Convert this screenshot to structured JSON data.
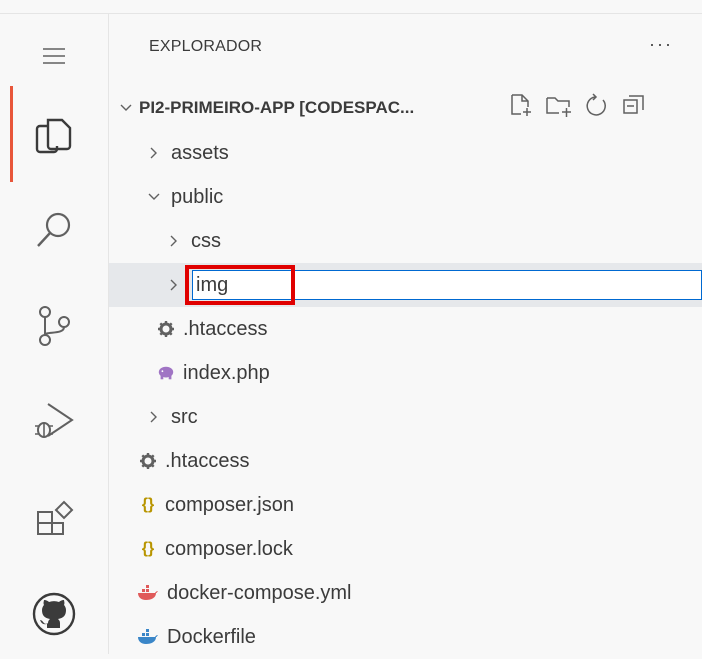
{
  "explorer": {
    "title": "EXPLORADOR",
    "more": "···",
    "project": "PI2-PRIMEIRO-APP [CODESPAC..."
  },
  "tree": [
    {
      "label": "assets",
      "type": "folder",
      "expanded": false
    },
    {
      "label": "public",
      "type": "folder",
      "expanded": true
    },
    {
      "label": "css",
      "type": "folder",
      "expanded": false
    },
    {
      "label": "img",
      "type": "folder-rename",
      "expanded": false
    },
    {
      "label": ".htaccess",
      "type": "gear"
    },
    {
      "label": "index.php",
      "type": "php"
    },
    {
      "label": "src",
      "type": "folder",
      "expanded": false
    },
    {
      "label": ".htaccess",
      "type": "gear"
    },
    {
      "label": "composer.json",
      "type": "json"
    },
    {
      "label": "composer.lock",
      "type": "json"
    },
    {
      "label": "docker-compose.yml",
      "type": "docker-red"
    },
    {
      "label": "Dockerfile",
      "type": "docker-blue"
    }
  ],
  "rename_value": "img",
  "colors": {
    "accent": "#e8563a",
    "focus_border": "#0069d1",
    "highlight": "#e00000",
    "json_icon": "#b89500",
    "php_icon": "#a074c4",
    "docker_red": "#e05a5a",
    "docker_blue": "#3a86c8"
  }
}
